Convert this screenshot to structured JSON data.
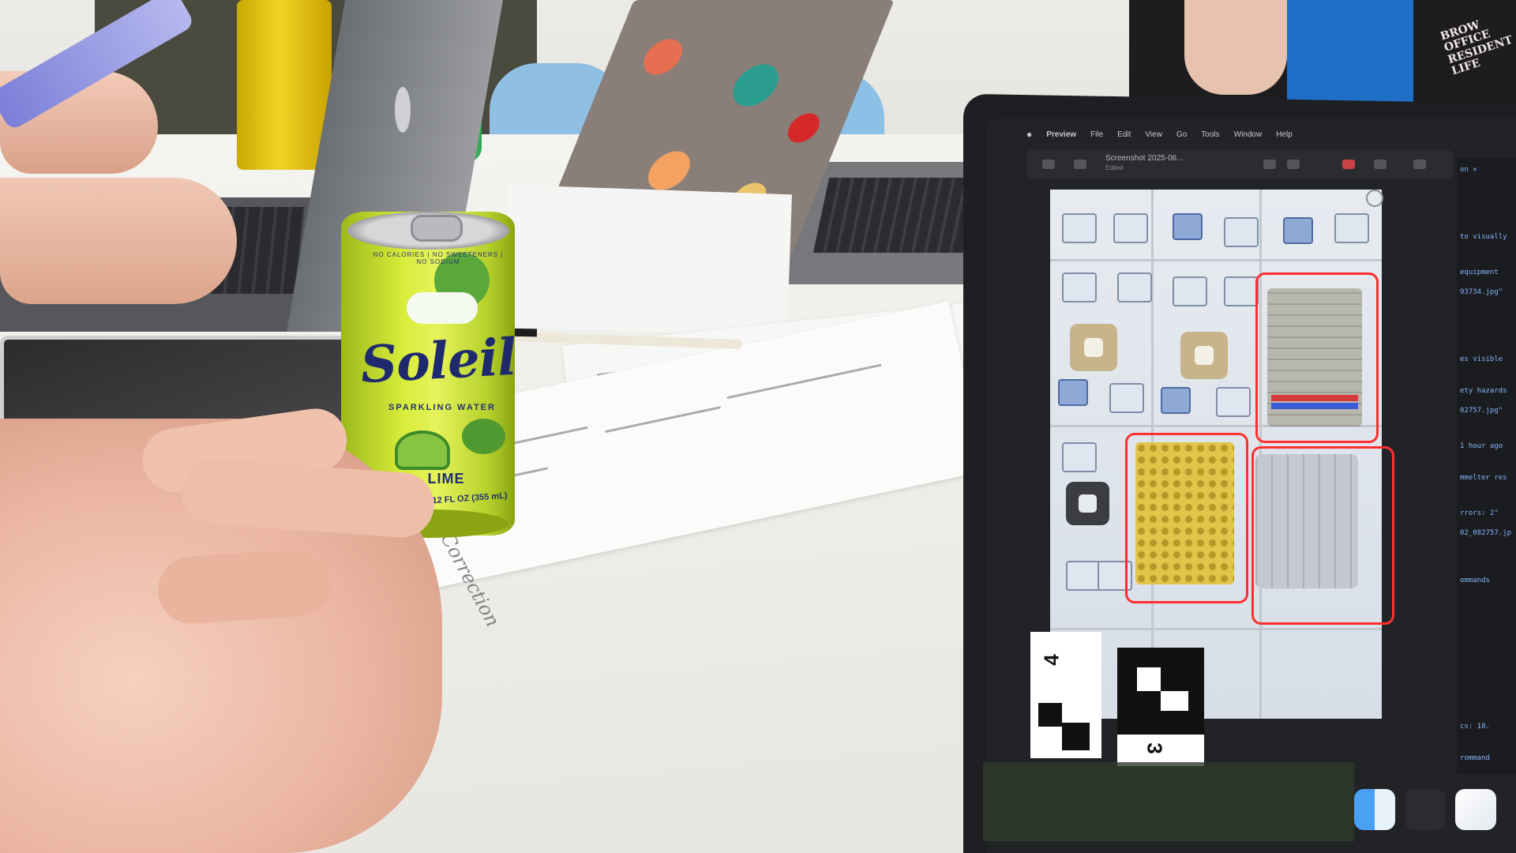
{
  "scene": {
    "description_free": true
  },
  "soleil_can": {
    "top_text": "NO CALORIES | NO SWEETENERS | NO SODIUM",
    "brand": "Soleil",
    "subtitle": "SPARKLING WATER",
    "flavor": "LIME",
    "volume": "12 FL OZ (355 mL)",
    "color": "#d7ec3a"
  },
  "paper": {
    "handwritten_word": "Correction"
  },
  "vest": {
    "text": "BROW OFFICE RESIDENT LIFE"
  },
  "preview_app": {
    "menu": [
      "Preview",
      "File",
      "Edit",
      "View",
      "Go",
      "Tools",
      "Window",
      "Help"
    ],
    "window_title": "Screenshot 2025-06...",
    "window_subtitle": "Edited",
    "aruco_labels": [
      "4",
      "3"
    ],
    "annotation_color": "#ff2f2f",
    "code_snippets": [
      "to visually",
      "equipment",
      "93734.jpg\"",
      "es visible",
      "ety hazards",
      "02757.jpg\"",
      "1 hour ago",
      "mmelter res",
      "rrors: 2\"",
      "02_082757.jp",
      "ommands",
      "cs: 10.",
      "rommand"
    ]
  },
  "dock": {
    "icons": [
      "finder-icon",
      "box-app-icon",
      "ai-app-icon"
    ]
  }
}
